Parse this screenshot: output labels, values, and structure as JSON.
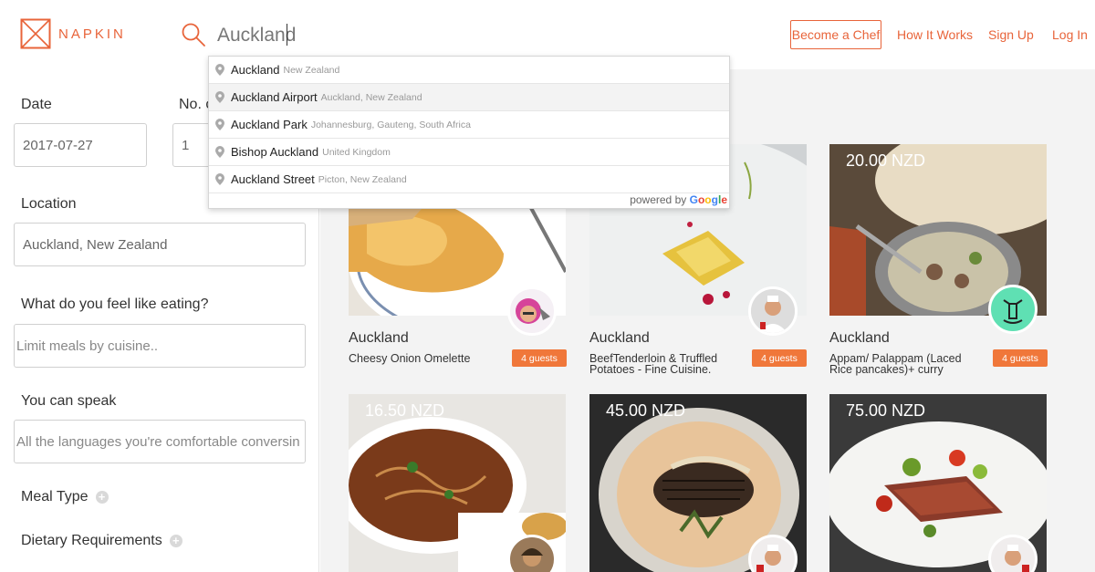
{
  "header": {
    "logo_text": "NAPKIN",
    "search_value": "Auckland",
    "nav": {
      "become_chef": "Become a Chef",
      "how_it_works": "How It Works",
      "sign_up": "Sign Up",
      "log_in": "Log In"
    }
  },
  "filters": {
    "date_label": "Date",
    "date_value": "2017-07-27",
    "guests_label": "No. o",
    "guests_value": "1",
    "location_label": "Location",
    "location_value": "Auckland, New Zealand",
    "cuisine_label": "What do you feel like eating?",
    "cuisine_placeholder": "Limit meals by cuisine..",
    "language_label": "You can speak",
    "language_placeholder": "All the languages you're comfortable conversin",
    "meal_type_label": "Meal Type",
    "dietary_label": "Dietary Requirements",
    "plus_icon": "+"
  },
  "autocomplete": {
    "suggestions": [
      {
        "main": "Auckland",
        "secondary": "New Zealand"
      },
      {
        "main": "Auckland Airport",
        "secondary": "Auckland, New Zealand"
      },
      {
        "main": "Auckland Park",
        "secondary": "Johannesburg, Gauteng, South Africa"
      },
      {
        "main": "Bishop Auckland",
        "secondary": "United Kingdom"
      },
      {
        "main": "Auckland Street",
        "secondary": "Picton, New Zealand"
      }
    ],
    "powered_by": "powered by",
    "google": [
      "G",
      "o",
      "o",
      "g",
      "l",
      "e"
    ]
  },
  "meals": [
    {
      "price": "",
      "city": "Auckland",
      "dish": "Cheesy Onion Omelette",
      "guests": "4 guests"
    },
    {
      "price": "",
      "city": "Auckland",
      "dish": "BeefTenderloin & Truffled Potatoes - Fine Cuisine.",
      "guests": "4 guests"
    },
    {
      "price": "20.00 NZD",
      "city": "Auckland",
      "dish": "Appam/ Palappam (Laced Rice pancakes)+ curry",
      "guests": "4 guests"
    },
    {
      "price": "16.50 NZD"
    },
    {
      "price": "45.00 NZD"
    },
    {
      "price": "75.00 NZD"
    }
  ],
  "colors": {
    "accent": "#e8643a",
    "badge": "#f0773a"
  },
  "icons": {
    "logo": "napkin-logo-icon",
    "search": "search-icon",
    "pin": "map-pin-icon"
  }
}
